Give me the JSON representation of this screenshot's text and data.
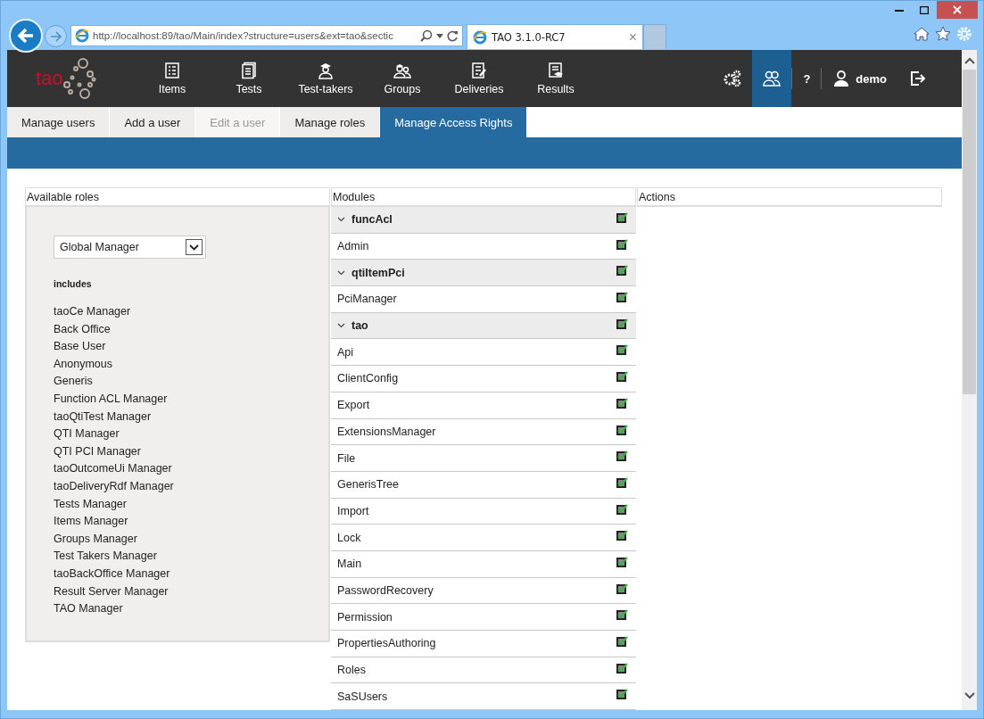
{
  "browser": {
    "url": "http://localhost:89/tao/Main/index?structure=users&ext=tao&sectic",
    "tab_title": "TAO 3.1.0-RC7",
    "tab_close": "×"
  },
  "app": {
    "logo": "tao",
    "nav": [
      {
        "label": "Items"
      },
      {
        "label": "Tests"
      },
      {
        "label": "Test-takers"
      },
      {
        "label": "Groups"
      },
      {
        "label": "Deliveries"
      },
      {
        "label": "Results"
      }
    ],
    "tools": [
      {
        "kind": "settings",
        "selected": false
      },
      {
        "kind": "users",
        "selected": true
      },
      {
        "kind": "help",
        "label": "?",
        "selected": false
      },
      {
        "kind": "user",
        "label": "demo",
        "selected": false
      },
      {
        "kind": "logout",
        "selected": false
      }
    ]
  },
  "tabs": [
    {
      "label": "Manage users",
      "selected": false,
      "disabled": false
    },
    {
      "label": "Add a user",
      "selected": false,
      "disabled": false
    },
    {
      "label": "Edit a user",
      "selected": false,
      "disabled": true
    },
    {
      "label": "Manage roles",
      "selected": false,
      "disabled": false
    },
    {
      "label": "Manage Access Rights",
      "selected": true,
      "disabled": false
    }
  ],
  "columns": [
    "Available roles",
    "Modules",
    "Actions"
  ],
  "roles": {
    "select": "Global Manager",
    "includes_label": "includes",
    "items": [
      "taoCe Manager",
      "Back Office",
      "Base User",
      "Anonymous",
      "Generis",
      "Function ACL Manager",
      "taoQtiTest Manager",
      "QTI Manager",
      "QTI PCI Manager",
      "taoOutcomeUi Manager",
      "taoDeliveryRdf Manager",
      "Tests Manager",
      "Items Manager",
      "Groups Manager",
      "Test Takers Manager",
      "taoBackOffice Manager",
      "Result Server Manager",
      "TAO Manager"
    ]
  },
  "modules": [
    {
      "name": "funcAcl",
      "expanded": true,
      "granted": true,
      "children": [
        {
          "name": "Admin",
          "granted": true
        }
      ]
    },
    {
      "name": "qtiItemPci",
      "expanded": true,
      "granted": true,
      "children": [
        {
          "name": "PciManager",
          "granted": true
        }
      ]
    },
    {
      "name": "tao",
      "expanded": true,
      "granted": true,
      "children": [
        {
          "name": "Api",
          "granted": true
        },
        {
          "name": "ClientConfig",
          "granted": true
        },
        {
          "name": "Export",
          "granted": true
        },
        {
          "name": "ExtensionsManager",
          "granted": true
        },
        {
          "name": "File",
          "granted": true
        },
        {
          "name": "GenerisTree",
          "granted": true
        },
        {
          "name": "Import",
          "granted": true
        },
        {
          "name": "Lock",
          "granted": true
        },
        {
          "name": "Main",
          "granted": true
        },
        {
          "name": "PasswordRecovery",
          "granted": true
        },
        {
          "name": "Permission",
          "granted": true
        },
        {
          "name": "PropertiesAuthoring",
          "granted": true
        },
        {
          "name": "Roles",
          "granted": true
        },
        {
          "name": "SaSUsers",
          "granted": true
        }
      ]
    }
  ]
}
